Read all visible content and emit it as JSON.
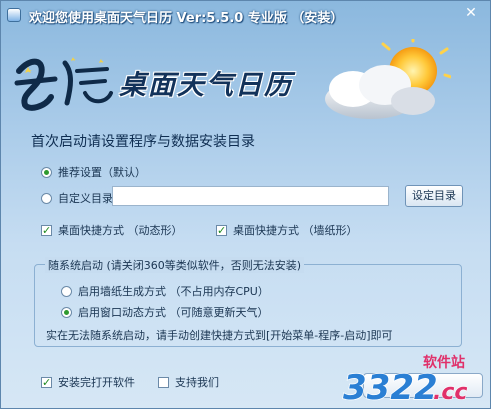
{
  "window": {
    "title": "欢迎您使用桌面天气日历 Ver:5.5.0 专业版 （安装）",
    "close_glyph": "✕"
  },
  "banner": {
    "logo_text": "星语",
    "title": "桌面天气日历"
  },
  "heading": "首次启动请设置程序与数据安装目录",
  "install_dir": {
    "recommended_label": "推荐设置（默认）",
    "custom_label": "自定义目录",
    "path_value": "",
    "browse_button": "设定目录"
  },
  "shortcuts": {
    "dynamic_label": "桌面快捷方式 （动态形）",
    "wallpaper_label": "桌面快捷方式 （墙纸形）"
  },
  "autostart": {
    "group_title": "随系统启动 (请关闭360等类似软件，否则无法安装)",
    "wallpaper_mode": "启用墙纸生成方式 （不占用内存CPU）",
    "window_mode": "启用窗口动态方式 （可随意更新天气）",
    "note": "实在无法随系统启动，请手动创建快捷方式到[开始菜单-程序-启动]即可"
  },
  "footer": {
    "open_after_install": "安装完打开软件",
    "support_us": "支持我们"
  },
  "watermark": {
    "site_name": "软件站",
    "number": "3322",
    "tld": ".cc"
  },
  "colors": {
    "accent_green": "#2f9a2f",
    "title_blue": "#12325a",
    "watermark_pink": "#e0306a",
    "watermark_blue": "#2a7fd4"
  }
}
